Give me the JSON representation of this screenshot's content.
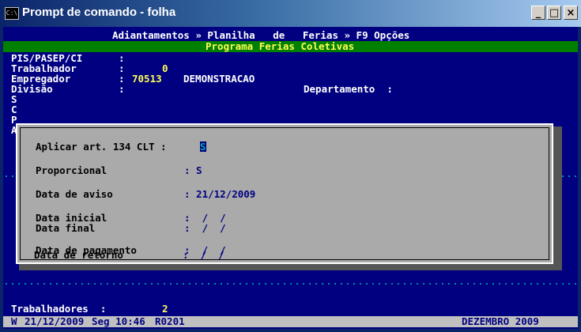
{
  "window": {
    "title": "Prompt de comando - folha",
    "icon_label": "C:\\",
    "buttons": {
      "minimize": "_",
      "maximize": "□",
      "close": "×"
    }
  },
  "menu": "Adiantamentos » Planilha   de   Ferias » F9 Opções",
  "subtitle": "Programa Ferias Coletivas",
  "header": {
    "pis_label": "PIS/PASEP/CI",
    "pis_colon": ":",
    "trabalhador_label": "Trabalhador",
    "trabalhador_colon": ":",
    "trabalhador_value": "0",
    "empregador_label": "Empregador",
    "empregador_colon": ":",
    "empregador_code": "70513",
    "empregador_name": "DEMONSTRACAO",
    "divisao_label": "Divisão",
    "divisao_colon": ":",
    "departamento_label": "Departamento  :",
    "side_letters": [
      "S",
      "C",
      "P",
      "A"
    ]
  },
  "dialog": {
    "aplicar_label": "Aplicar art. 134 CLT :",
    "aplicar_value": "S",
    "proporcional_label": "Proporcional",
    "proporcional_value": ": S",
    "data_aviso_label": "Data de aviso",
    "data_aviso_value": ": 21/12/2009",
    "data_inicial_label": "Data inicial",
    "data_inicial_value": ":  /  /",
    "data_final_label": "Data final",
    "data_final_value": ":  /  /",
    "data_pagamento_label": "Data de pagamento",
    "data_pagamento_value": ":  /  /",
    "data_retorno_label": "Data de retorno",
    "data_retorno_value": ":  /  /"
  },
  "footer": {
    "trabalhadores_label": "Trabalhadores  :",
    "trabalhadores_value": "2"
  },
  "status": {
    "flag": "W",
    "date": "21/12/2009",
    "day_time": "Seg 10:46",
    "code": "R0201",
    "month": "DEZEMBRO 2009"
  },
  "colors": {
    "console_bg": "#000080",
    "subtitle_bg": "#008000",
    "dialog_bg": "#aaaaaa",
    "status_bg": "#c0c0c0",
    "highlight_yellow": "#ffff55",
    "status_red": "#aa0000"
  }
}
